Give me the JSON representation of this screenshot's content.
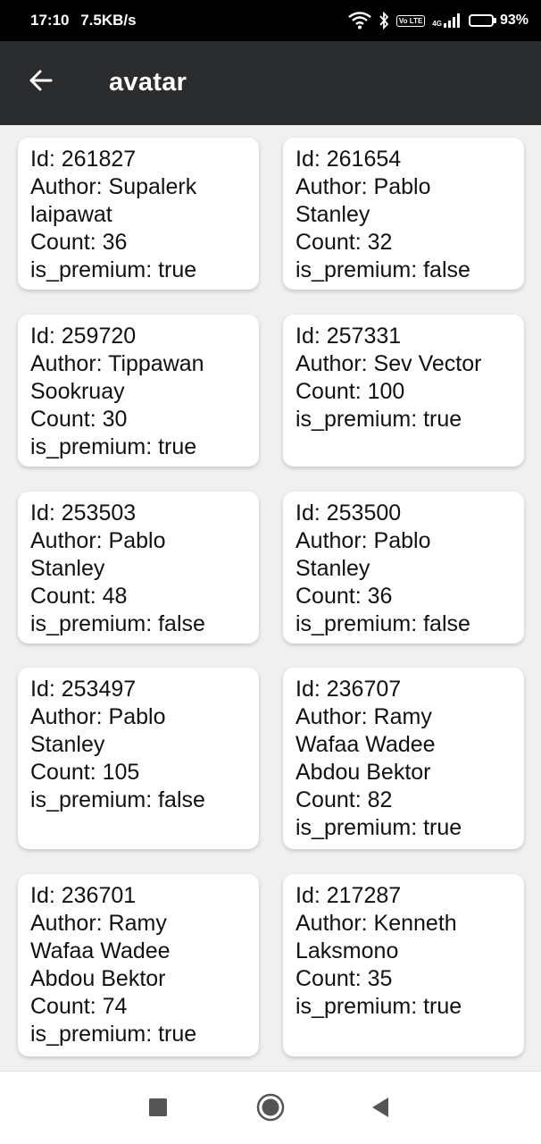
{
  "status_bar": {
    "time": "17:10",
    "speed": "7.5KB/s",
    "volte": "Vo LTE",
    "network": "4G",
    "battery_pct": "93%",
    "battery_level": 0.93
  },
  "app_bar": {
    "title": "avatar",
    "back_icon": "arrow-left-icon"
  },
  "cards": [
    {
      "id": "Id: 261827",
      "author_lines": [
        "Author: Supalerk",
        "laipawat"
      ],
      "count": "Count: 36",
      "premium": "is_premium: true"
    },
    {
      "id": "Id: 261654",
      "author_lines": [
        "Author: Pablo",
        "Stanley"
      ],
      "count": "Count: 32",
      "premium": "is_premium: false"
    },
    {
      "id": "Id: 259720",
      "author_lines": [
        "Author: Tippawan",
        "Sookruay"
      ],
      "count": "Count: 30",
      "premium": "is_premium: true"
    },
    {
      "id": "Id: 257331",
      "author_lines": [
        "Author: Sev Vector"
      ],
      "count": "Count: 100",
      "premium": "is_premium: true"
    },
    {
      "id": "Id: 253503",
      "author_lines": [
        "Author: Pablo",
        "Stanley"
      ],
      "count": "Count: 48",
      "premium": "is_premium: false"
    },
    {
      "id": "Id: 253500",
      "author_lines": [
        "Author: Pablo",
        "Stanley"
      ],
      "count": "Count: 36",
      "premium": "is_premium: false"
    },
    {
      "id": "Id: 253497",
      "author_lines": [
        "Author: Pablo",
        "Stanley"
      ],
      "count": "Count: 105",
      "premium": "is_premium: false"
    },
    {
      "id": "Id: 236707",
      "author_lines": [
        "Author: Ramy",
        "Wafaa Wadee",
        "Abdou Bektor"
      ],
      "count": "Count: 82",
      "premium": "is_premium: true"
    },
    {
      "id": "Id: 236701",
      "author_lines": [
        "Author: Ramy",
        "Wafaa Wadee",
        "Abdou Bektor"
      ],
      "count": "Count: 74",
      "premium": "is_premium: true"
    },
    {
      "id": "Id: 217287",
      "author_lines": [
        "Author: Kenneth",
        "Laksmono"
      ],
      "count": "Count: 35",
      "premium": "is_premium: true"
    }
  ],
  "nav_bar": {
    "recents_icon": "square-icon",
    "home_icon": "circle-icon",
    "back_icon": "triangle-back-icon"
  },
  "colors": {
    "status_bar_bg": "#000000",
    "app_bar_bg": "#2b2c2e",
    "page_bg": "#f0f0f0",
    "card_bg": "#ffffff",
    "text": "#111111",
    "nav_icon": "#555555"
  }
}
